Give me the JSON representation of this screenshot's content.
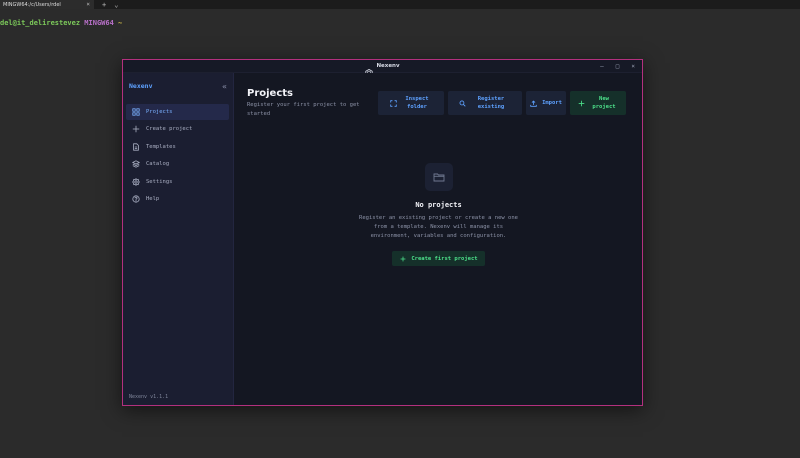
{
  "terminal": {
    "tab_label": "MINGW64:/c/Users/rdel",
    "tab_close": "×",
    "new_tab": "+",
    "tab_menu": "⌄",
    "prompt_user": "del@it_delirestevez",
    "prompt_system": "MINGW64",
    "prompt_path": "~"
  },
  "window": {
    "title": "Nexenv",
    "minimize": "–",
    "maximize": "□",
    "close": "×"
  },
  "sidebar": {
    "brand": "Nexenv",
    "collapse": "«",
    "items": [
      {
        "label": "Projects",
        "icon": "grid-icon",
        "active": true
      },
      {
        "label": "Create project",
        "icon": "plus-icon"
      },
      {
        "label": "Templates",
        "icon": "file-icon"
      },
      {
        "label": "Catalog",
        "icon": "layers-icon"
      },
      {
        "label": "Settings",
        "icon": "gear-icon"
      },
      {
        "label": "Help",
        "icon": "help-icon"
      }
    ],
    "version": "Nexenv v1.1.1"
  },
  "main": {
    "title": "Projects",
    "subtitle": "Register your first project to get started",
    "actions": [
      {
        "label": "Inspect folder",
        "icon": "scan-icon"
      },
      {
        "label": "Register existing",
        "icon": "search-icon"
      },
      {
        "label": "Import",
        "icon": "upload-icon"
      },
      {
        "label": "New project",
        "icon": "plus-icon"
      }
    ],
    "empty": {
      "title": "No projects",
      "description": "Register an existing project or create a new one from a template. Nexenv will manage its environment, variables and configuration.",
      "cta": "Create first project"
    }
  },
  "colors": {
    "accent_blue": "#5ea1ff",
    "accent_green": "#4ce08a",
    "window_border": "#b3307e",
    "background": "#141722",
    "sidebar": "#1b1e31"
  }
}
